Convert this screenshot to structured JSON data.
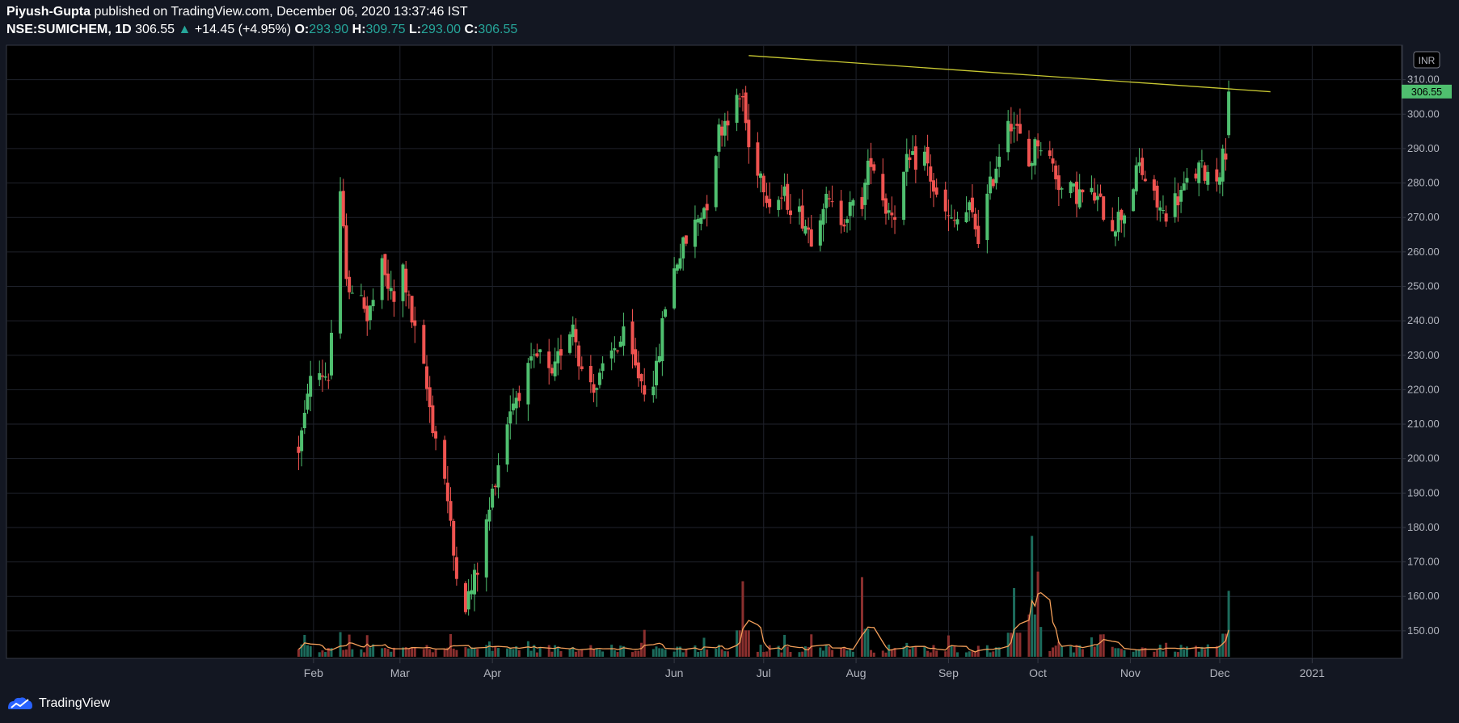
{
  "header": {
    "author": "Piyush-Gupta",
    "published_text": "published on TradingView.com, December 06, 2020 13:37:46 IST",
    "symbol": "NSE:SUMICHEM, 1D",
    "last": "306.55",
    "change_arrow": "▲",
    "change": "+14.45 (+4.95%)",
    "open_label": "O:",
    "open": "293.90",
    "high_label": "H:",
    "high": "309.75",
    "low_label": "L:",
    "low": "293.00",
    "close_label": "C:",
    "close": "306.55"
  },
  "footer": {
    "brand": "TradingView"
  },
  "colors": {
    "bg": "#131722",
    "pane": "#000000",
    "up": "#4fbf6f",
    "down": "#ef5350",
    "trend": "#c8c832",
    "ma": "#f5a05a",
    "grid": "#1f222b",
    "text": "#b2b5be"
  },
  "chart_data": {
    "type": "candlestick",
    "currency": "INR",
    "last_price_label": "306.55",
    "y_ticks": [
      "310.00",
      "300.00",
      "290.00",
      "280.00",
      "270.00",
      "260.00",
      "250.00",
      "240.00",
      "230.00",
      "220.00",
      "210.00",
      "200.00",
      "190.00",
      "180.00",
      "170.00",
      "160.00",
      "150.00"
    ],
    "ylim": [
      142,
      320
    ],
    "x_labels": [
      "Feb",
      "Mar",
      "Apr",
      "Jun",
      "Jul",
      "Aug",
      "Sep",
      "Oct",
      "Nov",
      "Dec",
      "2021"
    ],
    "x_label_dates": [
      "2020-02-01",
      "2020-03-01",
      "2020-04-01",
      "2020-06-01",
      "2020-07-01",
      "2020-08-01",
      "2020-09-01",
      "2020-10-01",
      "2020-11-01",
      "2020-12-01",
      "2021-01-01"
    ],
    "x_range": [
      "2019-10-21",
      "2021-01-31"
    ],
    "trend_line": {
      "from": {
        "date": "2020-06-26",
        "price": 317
      },
      "to": {
        "date": "2020-12-18",
        "price": 306.5
      }
    },
    "price_anchors": [
      [
        "2020-01-27",
        193,
        203
      ],
      [
        "2020-01-29",
        210,
        211
      ],
      [
        "2020-01-30",
        211,
        221
      ],
      [
        "2020-02-03",
        225
      ],
      [
        "2020-02-06",
        224
      ],
      [
        "2020-02-10",
        275
      ],
      [
        "2020-02-12",
        255
      ],
      [
        "2020-02-14",
        245
      ],
      [
        "2020-02-17",
        250
      ],
      [
        "2020-02-19",
        240
      ],
      [
        "2020-02-24",
        255
      ],
      [
        "2020-02-28",
        245
      ],
      [
        "2020-03-02",
        255
      ],
      [
        "2020-03-05",
        240
      ],
      [
        "2020-03-09",
        225
      ],
      [
        "2020-03-12",
        210
      ],
      [
        "2020-03-16",
        195
      ],
      [
        "2020-03-19",
        172
      ],
      [
        "2020-03-23",
        158
      ],
      [
        "2020-03-25",
        162
      ],
      [
        "2020-03-27",
        168
      ],
      [
        "2020-03-31",
        185
      ],
      [
        "2020-04-02",
        195
      ],
      [
        "2020-04-07",
        215
      ],
      [
        "2020-04-13",
        225
      ],
      [
        "2020-04-17",
        230
      ],
      [
        "2020-04-21",
        222
      ],
      [
        "2020-04-24",
        232
      ],
      [
        "2020-04-28",
        240
      ],
      [
        "2020-05-01",
        225
      ],
      [
        "2020-05-06",
        221
      ],
      [
        "2020-05-12",
        232
      ],
      [
        "2020-05-15",
        235
      ],
      [
        "2020-05-19",
        226
      ],
      [
        "2020-05-22",
        221
      ],
      [
        "2020-05-26",
        225
      ],
      [
        "2020-05-29",
        245
      ],
      [
        "2020-06-02",
        258
      ],
      [
        "2020-06-08",
        268
      ],
      [
        "2020-06-12",
        275
      ],
      [
        "2020-06-16",
        295
      ],
      [
        "2020-06-19",
        300
      ],
      [
        "2020-06-24",
        305
      ],
      [
        "2020-06-26",
        290
      ],
      [
        "2020-06-30",
        283
      ],
      [
        "2020-07-03",
        275
      ],
      [
        "2020-07-08",
        276
      ],
      [
        "2020-07-14",
        270
      ],
      [
        "2020-07-17",
        265
      ],
      [
        "2020-07-21",
        275
      ],
      [
        "2020-07-27",
        270
      ],
      [
        "2020-08-03",
        275
      ],
      [
        "2020-08-06",
        288
      ],
      [
        "2020-08-11",
        273
      ],
      [
        "2020-08-14",
        272
      ],
      [
        "2020-08-18",
        285
      ],
      [
        "2020-08-24",
        288
      ],
      [
        "2020-08-28",
        275
      ],
      [
        "2020-09-02",
        268
      ],
      [
        "2020-09-08",
        272
      ],
      [
        "2020-09-11",
        265
      ],
      [
        "2020-09-16",
        282
      ],
      [
        "2020-09-21",
        300
      ],
      [
        "2020-09-24",
        295
      ],
      [
        "2020-09-28",
        285
      ],
      [
        "2020-10-01",
        293
      ],
      [
        "2020-10-06",
        285
      ],
      [
        "2020-10-09",
        278
      ],
      [
        "2020-10-14",
        277
      ],
      [
        "2020-10-20",
        276
      ],
      [
        "2020-10-26",
        268
      ],
      [
        "2020-10-30",
        272
      ],
      [
        "2020-11-04",
        285
      ],
      [
        "2020-11-09",
        275
      ],
      [
        "2020-11-12",
        271
      ],
      [
        "2020-11-18",
        277
      ],
      [
        "2020-11-24",
        284
      ],
      [
        "2020-11-30",
        282
      ],
      [
        "2020-12-03",
        290
      ],
      [
        "2020-12-04",
        293.9,
        306.55,
        293,
        309.75
      ]
    ],
    "volume_spikes": [
      [
        "2020-06-24",
        0.55
      ],
      [
        "2020-08-03",
        0.58
      ],
      [
        "2020-09-23",
        0.5
      ],
      [
        "2020-09-29",
        0.88
      ],
      [
        "2020-10-01",
        0.62
      ],
      [
        "2020-12-04",
        0.48
      ]
    ]
  }
}
